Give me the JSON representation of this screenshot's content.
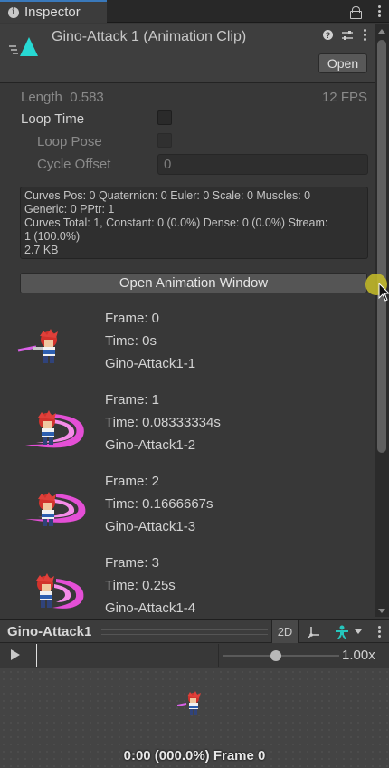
{
  "tab": {
    "title": "Inspector"
  },
  "header": {
    "title": "Gino-Attack 1 (Animation Clip)",
    "open_label": "Open"
  },
  "settings": {
    "length_label": "Length",
    "length_value": "0.583",
    "fps": "12 FPS",
    "loop_time_label": "Loop Time",
    "loop_time_checked": false,
    "loop_pose_label": "Loop Pose",
    "cycle_offset_label": "Cycle Offset",
    "cycle_offset_value": "0"
  },
  "info": {
    "line1": "Curves Pos: 0 Quaternion: 0 Euler: 0 Scale: 0 Muscles: 0",
    "line2": "Generic: 0 PPtr: 1",
    "line3": "Curves Total: 1, Constant: 0 (0.0%) Dense: 0 (0.0%) Stream:",
    "line4": "1 (100.0%)",
    "line5": "2.7 KB"
  },
  "open_animation_window_label": "Open Animation Window",
  "frames": [
    {
      "frame": "Frame: 0",
      "time": "Time: 0s",
      "sprite": "Gino-Attack1-1"
    },
    {
      "frame": "Frame: 1",
      "time": "Time: 0.08333334s",
      "sprite": "Gino-Attack1-2"
    },
    {
      "frame": "Frame: 2",
      "time": "Time: 0.1666667s",
      "sprite": "Gino-Attack1-3"
    },
    {
      "frame": "Frame: 3",
      "time": "Time: 0.25s",
      "sprite": "Gino-Attack1-4"
    }
  ],
  "preview": {
    "title": "Gino-Attack1",
    "mode_2d_label": "2D",
    "speed": "1.00x",
    "status": "0:00 (000.0%) Frame 0",
    "speed_slider_fraction": 0.45
  },
  "colors": {
    "accent": "#3a79bb",
    "clip_icon": "#27d9d3",
    "slash": "#e44fd6",
    "avatar_icon": "#26c7be"
  },
  "icons": {
    "tab": "info-icon",
    "clip": "animation-clip-icon",
    "header": [
      "help-icon",
      "presets-icon",
      "menu-icon"
    ],
    "preview": [
      "2d-toggle",
      "pivot-icon",
      "avatar-icon"
    ]
  }
}
